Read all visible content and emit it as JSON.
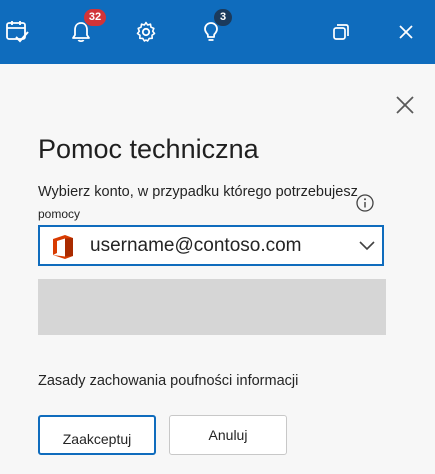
{
  "titlebar": {
    "background": "#0f6cbd",
    "icons": [
      {
        "name": "calendar-check-icon"
      },
      {
        "name": "bell-icon",
        "badge": "32",
        "badge_color": "#d13438"
      },
      {
        "name": "gear-icon"
      },
      {
        "name": "lightbulb-icon",
        "badge": "3",
        "badge_color": "#1b3a5c"
      },
      {
        "name": "restore-window-icon"
      },
      {
        "name": "close-window-icon"
      }
    ]
  },
  "dialog": {
    "title": "Pomoc techniczna",
    "prompt_line1": "Wybierz konto, w przypadku którego potrzebujesz",
    "prompt_line2": "pomocy",
    "account": {
      "selected": "username@contoso.com",
      "icon": "office-logo-icon"
    },
    "privacy_text": "Zasady zachowania poufności informacji",
    "accept_label": "Zaakceptuj",
    "cancel_label": "Anuluj"
  },
  "colors": {
    "accent": "#0f6cbd",
    "office_red": "#d83b01"
  }
}
